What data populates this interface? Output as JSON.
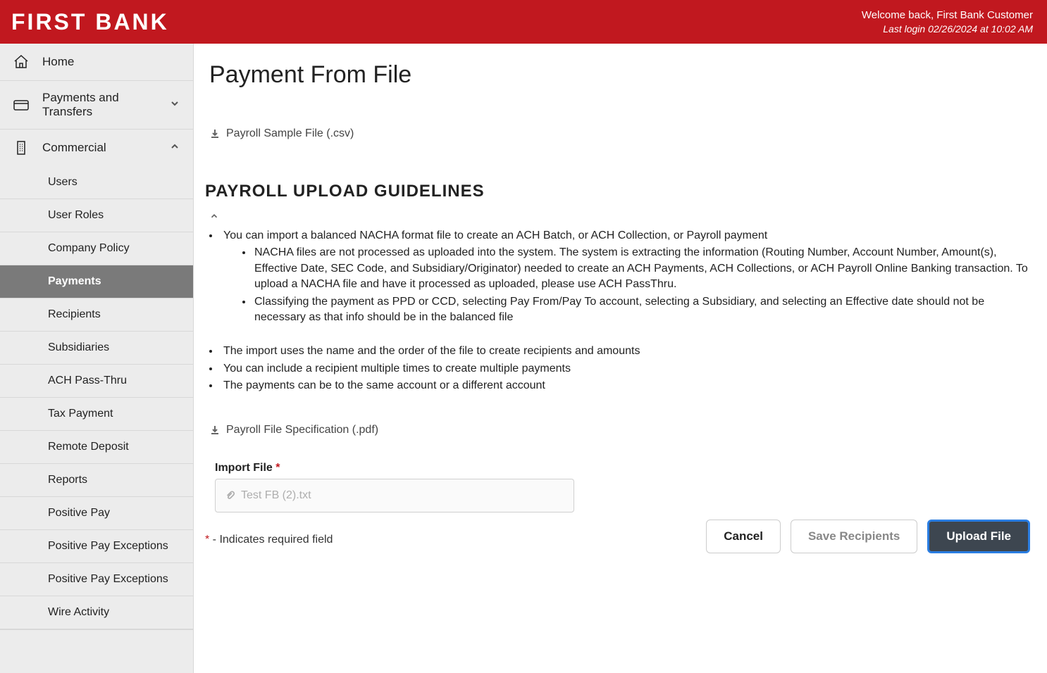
{
  "header": {
    "logo": "FIRST BANK",
    "welcome": "Welcome back, First Bank Customer",
    "last_login": "Last login 02/26/2024 at 10:02 AM"
  },
  "sidebar": {
    "home": "Home",
    "pnt": "Payments and Transfers",
    "commercial": "Commercial",
    "items": [
      "Users",
      "User Roles",
      "Company Policy",
      "Payments",
      "Recipients",
      "Subsidiaries",
      "ACH Pass-Thru",
      "Tax Payment",
      "Remote Deposit",
      "Reports",
      "Positive Pay",
      "Positive Pay Exceptions",
      "Positive Pay Exceptions",
      "Wire Activity"
    ],
    "active_index": 3
  },
  "main": {
    "title": "Payment From File",
    "sample_link": "Payroll Sample File (.csv)",
    "guidelines_heading": "PAYROLL UPLOAD GUIDELINES",
    "g1": "You can import a balanced NACHA format file to create an ACH Batch, or ACH Collection, or Payroll payment",
    "g1a": "NACHA files are not processed as uploaded into the system. The system is extracting the information (Routing Number, Account Number, Amount(s), Effective Date, SEC Code, and Subsidiary/Originator) needed to create an ACH Payments, ACH Collections, or ACH Payroll Online Banking transaction. To upload a NACHA file and have it processed as uploaded, please use ACH PassThru.",
    "g1b": "Classifying the payment as PPD or CCD, selecting Pay From/Pay To account, selecting a Subsidiary, and selecting an Effective date should not be necessary as that info should be in the balanced file",
    "g2": "The import uses the name and the order of the file to create recipients and amounts",
    "g3": "You can include a recipient multiple times to create multiple payments",
    "g4": "The payments can be to the same account or a different account",
    "spec_link": "Payroll File Specification (.pdf)",
    "import_label": "Import File",
    "import_value": "Test FB (2).txt",
    "required_note": " - Indicates required field",
    "buttons": {
      "cancel": "Cancel",
      "save_recipients": "Save Recipients",
      "upload": "Upload File"
    }
  }
}
